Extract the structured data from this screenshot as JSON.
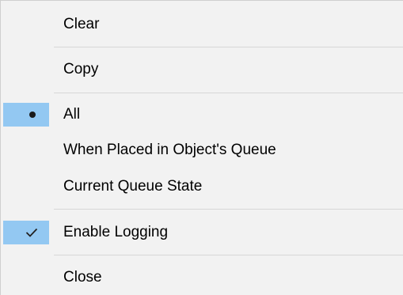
{
  "menu": {
    "items": [
      {
        "label": "Clear"
      },
      {
        "label": "Copy"
      },
      {
        "label": "All",
        "mark": "bullet-icon"
      },
      {
        "label": "When Placed in Object's Queue"
      },
      {
        "label": "Current Queue State"
      },
      {
        "label": "Enable Logging",
        "mark": "checkmark-icon"
      },
      {
        "label": "Close"
      }
    ],
    "mark_highlight_color": "#93c8f2",
    "background_color": "#f2f2f2"
  }
}
